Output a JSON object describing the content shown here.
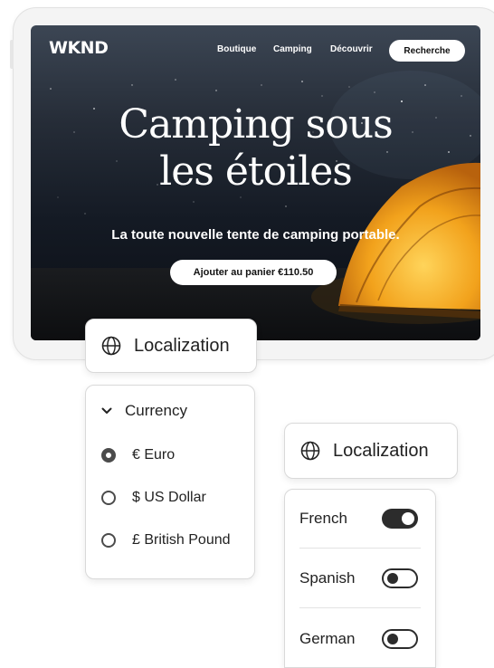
{
  "site": {
    "logo": "WKND",
    "nav": [
      "Boutique",
      "Camping",
      "Découvrir"
    ],
    "search_label": "Recherche",
    "hero_title_line1": "Camping sous",
    "hero_title_line2": "les étoiles",
    "hero_subtitle": "La toute nouvelle tente de camping portable.",
    "cart_button": "Ajouter au panier €110.50"
  },
  "localization_panel_1": {
    "title": "Localization",
    "icon": "globe-icon"
  },
  "currency": {
    "header": "Currency",
    "options": [
      {
        "label": "€ Euro",
        "selected": true
      },
      {
        "label": "$ US Dollar",
        "selected": false
      },
      {
        "label": "£ British Pound",
        "selected": false
      }
    ]
  },
  "localization_panel_2": {
    "title": "Localization",
    "icon": "globe-icon"
  },
  "languages": [
    {
      "label": "French",
      "enabled": true
    },
    {
      "label": "Spanish",
      "enabled": false
    },
    {
      "label": "German",
      "enabled": false
    }
  ],
  "colors": {
    "accent": "#2c2c2c",
    "tent": "#f2a21c",
    "sky": "#1f2633"
  }
}
